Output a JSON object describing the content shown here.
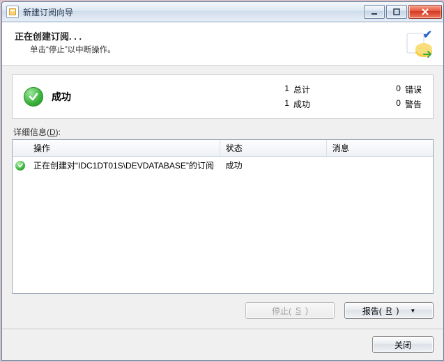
{
  "window": {
    "title": "新建订阅向导"
  },
  "header": {
    "title": "正在创建订阅. . .",
    "subtitle": "单击“停止”以中断操作。"
  },
  "status": {
    "title": "成功",
    "counts": {
      "total_num": "1",
      "total_label": "总计",
      "success_num": "1",
      "success_label": "成功",
      "error_num": "0",
      "error_label": "错误",
      "warning_num": "0",
      "warning_label": "警告"
    }
  },
  "details": {
    "label_prefix": "详细信息(",
    "label_accel": "D",
    "label_suffix": "):",
    "columns": {
      "operation": "操作",
      "state": "状态",
      "message": "消息"
    },
    "rows": [
      {
        "icon": "success",
        "operation": "正在创建对“IDC1DT01S\\DEVDATABASE”的订阅",
        "state": "成功",
        "message": ""
      }
    ]
  },
  "buttons": {
    "stop_prefix": "停止(",
    "stop_accel": "S",
    "stop_suffix": ")",
    "report_prefix": "报告(",
    "report_accel": "R",
    "report_suffix": ")",
    "close": "关闭"
  }
}
